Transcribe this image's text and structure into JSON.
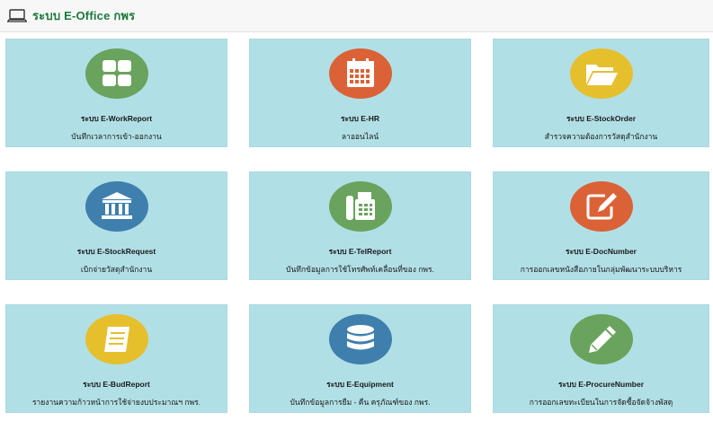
{
  "header": {
    "title": "ระบบ E-Office กพร",
    "icon": "laptop-icon"
  },
  "tiles": [
    {
      "name": "ระบบ E-WorkReport",
      "desc": "บันทึกเวลาการเข้า-ออกงาน",
      "icon": "grid-icon",
      "color": "#6aa35d"
    },
    {
      "name": "ระบบ E-HR",
      "desc": "ลาออนไลน์",
      "icon": "calendar-icon",
      "color": "#db6236"
    },
    {
      "name": "ระบบ E-StockOrder",
      "desc": "สำรวจความต้องการวัสดุสำนักงาน",
      "icon": "folder-icon",
      "color": "#e6bf2c"
    },
    {
      "name": "ระบบ E-StockRequest",
      "desc": "เบิกจ่ายวัสดุสำนักงาน",
      "icon": "bank-icon",
      "color": "#3e7fad"
    },
    {
      "name": "ระบบ E-TelReport",
      "desc": "บันทึกข้อมูลการใช้โทรศัพท์เคลื่อนที่ของ กพร.",
      "icon": "phone-icon",
      "color": "#6aa35d"
    },
    {
      "name": "ระบบ E-DocNumber",
      "desc": "การออกเลขหนังสือภายในกลุ่มพัฒนาระบบบริหาร",
      "icon": "edit-icon",
      "color": "#db6236"
    },
    {
      "name": "ระบบ E-BudReport",
      "desc": "รายงานความก้าวหน้าการใช้จ่ายงบประมาณฯ กพร.",
      "icon": "notepad-icon",
      "color": "#e6bf2c"
    },
    {
      "name": "ระบบ E-Equipment",
      "desc": "บันทึกข้อมูลการยืม - คืน ครุภัณฑ์ของ กพร.",
      "icon": "database-icon",
      "color": "#3e7fad"
    },
    {
      "name": "ระบบ E-ProcureNumber",
      "desc": "การออกเลขทะเบียนในการจัดซื้อจัดจ้างพัสดุ",
      "icon": "pencil-icon",
      "color": "#6aa35d"
    }
  ]
}
